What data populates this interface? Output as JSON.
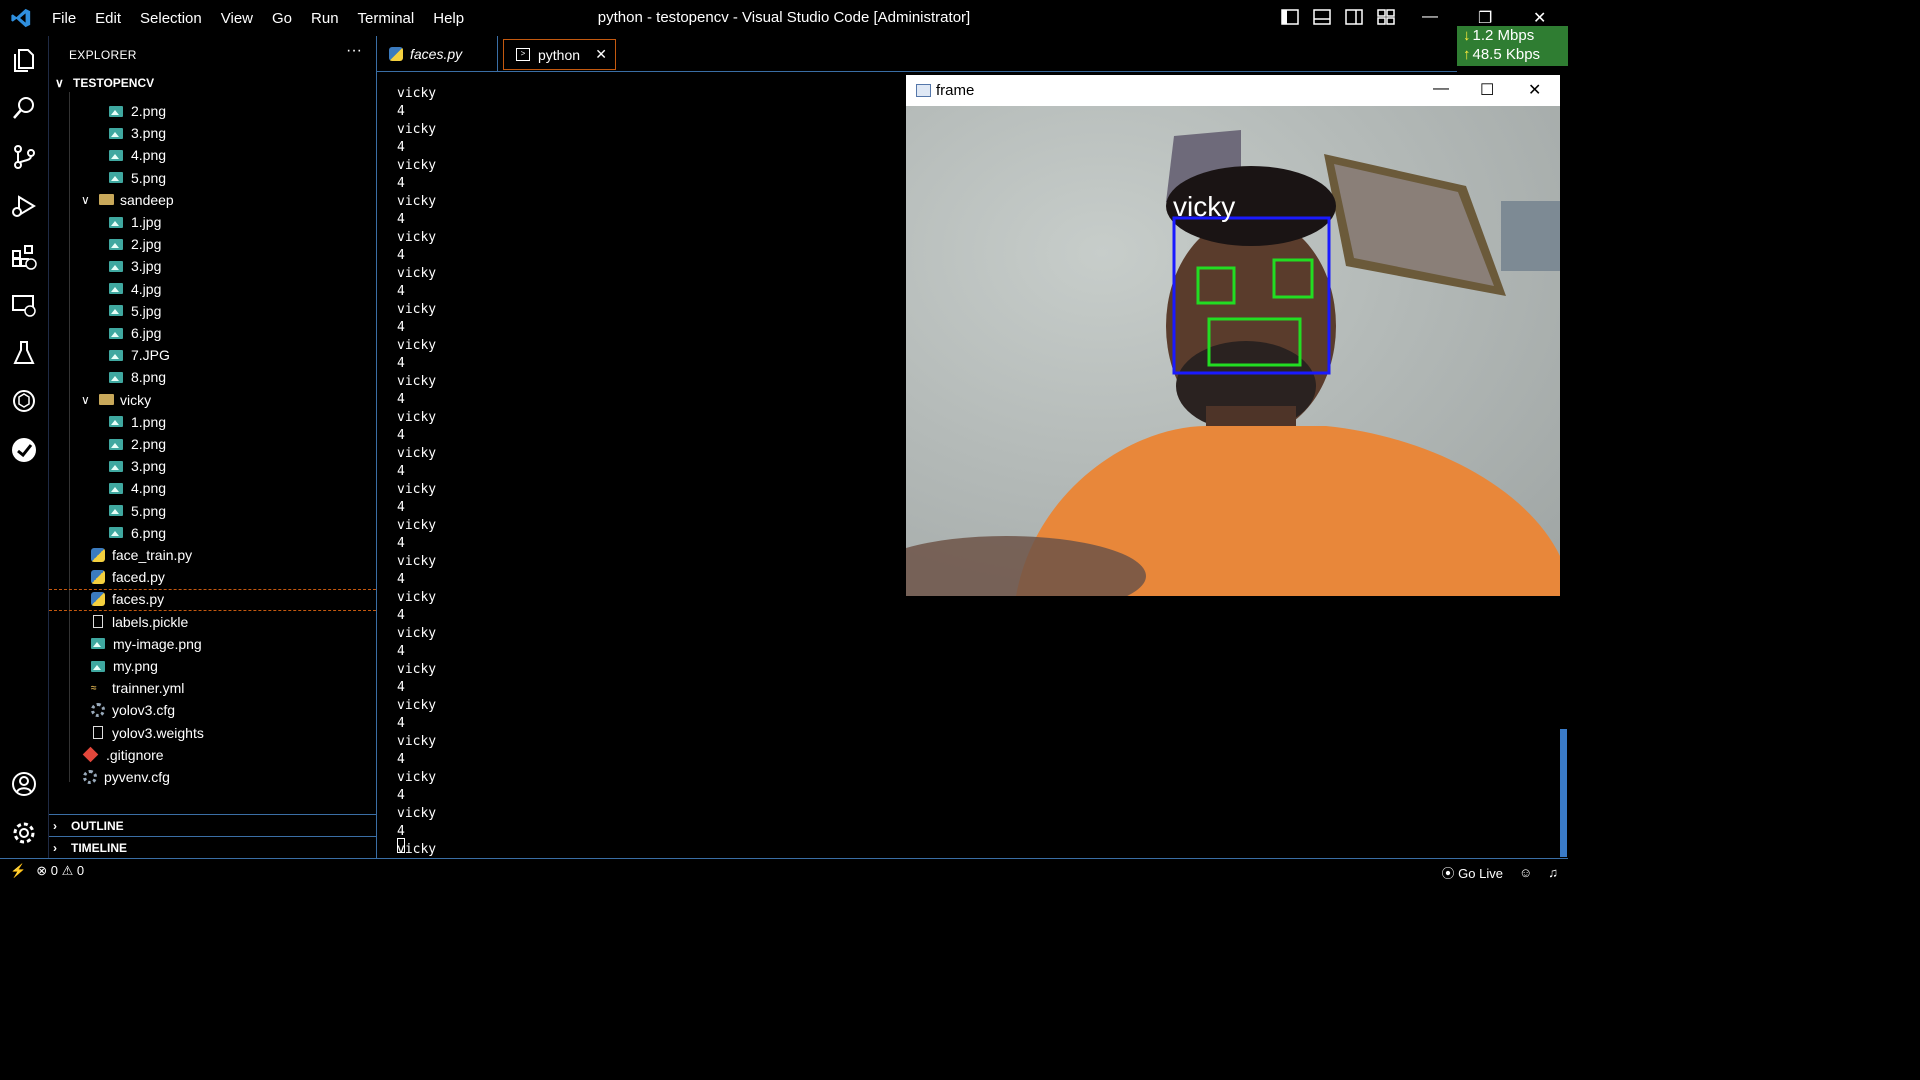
{
  "app": {
    "window_title": "python - testopencv - Visual Studio Code [Administrator]",
    "menu": [
      "File",
      "Edit",
      "Selection",
      "View",
      "Go",
      "Run",
      "Terminal",
      "Help"
    ]
  },
  "netmeter": {
    "download": "1.2 Mbps",
    "upload": "48.5 Kbps"
  },
  "explorer": {
    "header": "EXPLORER",
    "more": "···",
    "project": "TESTOPENCV",
    "items": [
      {
        "label": "2.png",
        "icon": "image-icon"
      },
      {
        "label": "3.png",
        "icon": "image-icon"
      },
      {
        "label": "4.png",
        "icon": "image-icon"
      },
      {
        "label": "5.png",
        "icon": "image-icon"
      },
      {
        "label": "sandeep",
        "icon": "folder-icon"
      },
      {
        "label": "1.jpg",
        "icon": "image-icon"
      },
      {
        "label": "2.jpg",
        "icon": "image-icon"
      },
      {
        "label": "3.jpg",
        "icon": "image-icon"
      },
      {
        "label": "4.jpg",
        "icon": "image-icon"
      },
      {
        "label": "5.jpg",
        "icon": "image-icon"
      },
      {
        "label": "6.jpg",
        "icon": "image-icon"
      },
      {
        "label": "7.JPG",
        "icon": "image-icon"
      },
      {
        "label": "8.png",
        "icon": "image-icon"
      },
      {
        "label": "vicky",
        "icon": "folder-icon"
      },
      {
        "label": "1.png",
        "icon": "image-icon"
      },
      {
        "label": "2.png",
        "icon": "image-icon"
      },
      {
        "label": "3.png",
        "icon": "image-icon"
      },
      {
        "label": "4.png",
        "icon": "image-icon"
      },
      {
        "label": "5.png",
        "icon": "image-icon"
      },
      {
        "label": "6.png",
        "icon": "image-icon"
      },
      {
        "label": "face_train.py",
        "icon": "python-icon"
      },
      {
        "label": "faced.py",
        "icon": "python-icon"
      },
      {
        "label": "faces.py",
        "icon": "python-icon"
      },
      {
        "label": "labels.pickle",
        "icon": "file-icon"
      },
      {
        "label": "my-image.png",
        "icon": "image-icon"
      },
      {
        "label": "my.png",
        "icon": "image-icon"
      },
      {
        "label": "trainner.yml",
        "icon": "yaml-icon"
      },
      {
        "label": "yolov3.cfg",
        "icon": "gear-icon"
      },
      {
        "label": "yolov3.weights",
        "icon": "file-icon"
      },
      {
        "label": ".gitignore",
        "icon": "git-icon"
      },
      {
        "label": "pyvenv.cfg",
        "icon": "gear-icon"
      }
    ],
    "outline": "OUTLINE",
    "timeline": "TIMELINE"
  },
  "tabs": [
    {
      "label": "faces.py"
    },
    {
      "label": "python",
      "close": "✕"
    }
  ],
  "terminal": {
    "name_line": "vicky",
    "id_line": "4"
  },
  "frame_window": {
    "title": "frame",
    "face_label": "vicky",
    "colors": {
      "face_box": "#1a1aff",
      "feature_box": "#22dd22",
      "label": "#ffffff"
    }
  },
  "statusbar": {
    "errors": "0",
    "warnings": "0",
    "golive": "Go Live"
  }
}
